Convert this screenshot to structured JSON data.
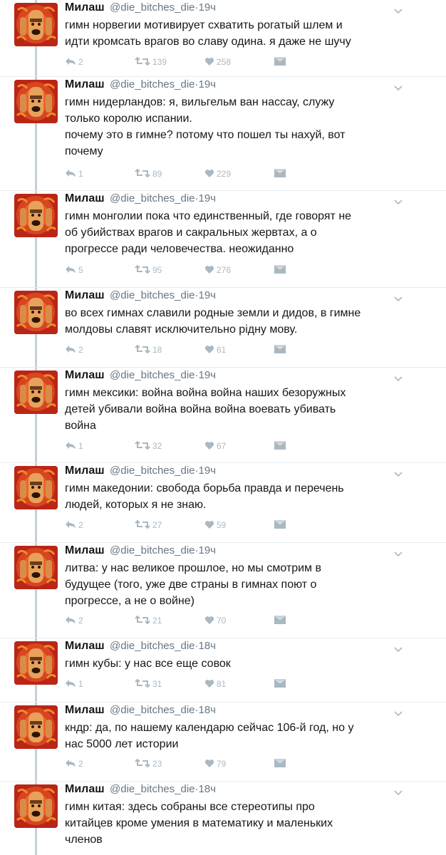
{
  "author": {
    "name": "Милаш",
    "handle": "@die_bitches_die",
    "separator": "·"
  },
  "icons": {
    "reply": "reply-icon",
    "retweet": "retweet-icon",
    "like": "heart-icon",
    "dm": "direct-message-icon",
    "caret": "chevron-down-icon",
    "avatar": "avatar-image"
  },
  "colors": {
    "action_gray": "#aab8c2",
    "secondary_text": "#657786",
    "thread_line": "#c4cfd6"
  },
  "tweets": [
    {
      "time": "19ч",
      "text": "гимн норвегии мотивирует схватить рогатый шлем и\nидти кромсать врагов во славу одина. я даже не шучу",
      "replies": "2",
      "retweets": "139",
      "likes": "258"
    },
    {
      "time": "19ч",
      "text": "гимн нидерландов: я, вильгельм ван нассау, служу\nтолько королю испании.\nпочему это в гимне? потому что пошел ты нахуй, вот\nпочему",
      "replies": "1",
      "retweets": "89",
      "likes": "229"
    },
    {
      "time": "19ч",
      "text": "гимн монголии пока что единственный, где говорят не\nоб убийствах врагов и сакральных жервтах, а о\nпрогрессе ради человечества. неожиданно",
      "replies": "5",
      "retweets": "95",
      "likes": "276"
    },
    {
      "time": "19ч",
      "text": "во всех гимнах славили родные земли и дидов, в гимне\nмолдовы славят исключительно рідну мову.",
      "replies": "2",
      "retweets": "18",
      "likes": "61"
    },
    {
      "time": "19ч",
      "text": "гимн мексики: война война война наших безоружных\nдетей убивали война война война воевать убивать\nвойна",
      "replies": "1",
      "retweets": "32",
      "likes": "67"
    },
    {
      "time": "19ч",
      "text": "гимн македонии: свобода борьба правда и перечень\nлюдей, которых я не знаю.",
      "replies": "2",
      "retweets": "27",
      "likes": "59"
    },
    {
      "time": "19ч",
      "text": "литва: у нас великое прошлое, но мы смотрим в\nбудущее (того, уже две страны в гимнах поют о\nпрогрессе, а не о войне)",
      "replies": "2",
      "retweets": "21",
      "likes": "70"
    },
    {
      "time": "18ч",
      "text": "гимн кубы: у нас все еще совок",
      "replies": "1",
      "retweets": "31",
      "likes": "81"
    },
    {
      "time": "18ч",
      "text": "кндр: да, по нашему календарю сейчас 106-й год, но у\nнас 5000 лет истории",
      "replies": "2",
      "retweets": "23",
      "likes": "79"
    },
    {
      "time": "18ч",
      "text": "гимн китая: здесь собраны все стереотипы про\nкитайцев кроме умения в математику и маленьких\nчленов",
      "replies": "",
      "retweets": "",
      "likes": ""
    }
  ]
}
